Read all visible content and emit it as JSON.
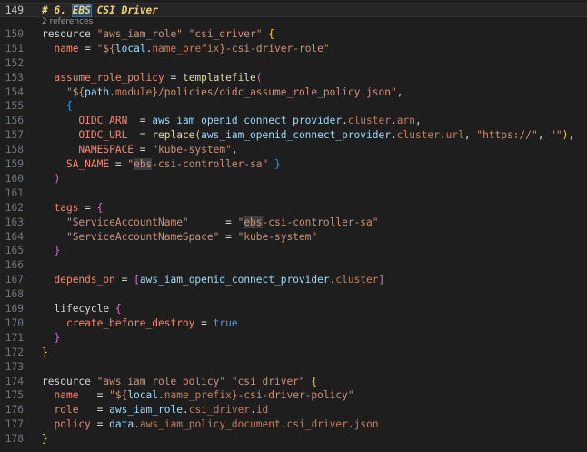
{
  "codelens": "2 references",
  "lines": [
    {
      "n": "149",
      "tokens": [
        {
          "c": "comment",
          "t": "# 6. "
        },
        {
          "c": "comment hl-box",
          "t": "EBS"
        },
        {
          "c": "comment",
          "t": " CSI Driver"
        }
      ]
    },
    {
      "n": "150",
      "tokens": [
        {
          "c": "kw",
          "t": "resource "
        },
        {
          "c": "str",
          "t": "\"aws_iam_role\""
        },
        {
          "c": "kw",
          "t": " "
        },
        {
          "c": "str",
          "t": "\"csi_driver\""
        },
        {
          "c": "kw",
          "t": " "
        },
        {
          "c": "b1",
          "t": "{"
        }
      ]
    },
    {
      "n": "151",
      "tokens": [
        {
          "c": "kw",
          "t": "  "
        },
        {
          "c": "prop",
          "t": "name"
        },
        {
          "c": "kw",
          "t": " = "
        },
        {
          "c": "str",
          "t": "\"${"
        },
        {
          "c": "ident",
          "t": "local"
        },
        {
          "c": "punct",
          "t": "."
        },
        {
          "c": "attr",
          "t": "name_prefix"
        },
        {
          "c": "str",
          "t": "}-csi-driver-role\""
        }
      ]
    },
    {
      "n": "152",
      "tokens": []
    },
    {
      "n": "153",
      "tokens": [
        {
          "c": "kw",
          "t": "  "
        },
        {
          "c": "prop",
          "t": "assume_role_policy"
        },
        {
          "c": "kw",
          "t": " = "
        },
        {
          "c": "func",
          "t": "templatefile"
        },
        {
          "c": "b2",
          "t": "("
        }
      ]
    },
    {
      "n": "154",
      "tokens": [
        {
          "c": "kw",
          "t": "    "
        },
        {
          "c": "str",
          "t": "\"${"
        },
        {
          "c": "ident",
          "t": "path"
        },
        {
          "c": "punct",
          "t": "."
        },
        {
          "c": "attr",
          "t": "module"
        },
        {
          "c": "str",
          "t": "}/policies/oidc_assume_role_policy.json\""
        },
        {
          "c": "punct",
          "t": ","
        }
      ]
    },
    {
      "n": "155",
      "tokens": [
        {
          "c": "kw",
          "t": "    "
        },
        {
          "c": "b3",
          "t": "{"
        }
      ]
    },
    {
      "n": "156",
      "tokens": [
        {
          "c": "kw",
          "t": "      "
        },
        {
          "c": "prop",
          "t": "OIDC_ARN"
        },
        {
          "c": "kw",
          "t": "  = "
        },
        {
          "c": "ident",
          "t": "aws_iam_openid_connect_provider"
        },
        {
          "c": "punct",
          "t": "."
        },
        {
          "c": "attr",
          "t": "cluster"
        },
        {
          "c": "punct",
          "t": "."
        },
        {
          "c": "attr",
          "t": "arn"
        },
        {
          "c": "punct",
          "t": ","
        }
      ]
    },
    {
      "n": "157",
      "tokens": [
        {
          "c": "kw",
          "t": "      "
        },
        {
          "c": "prop",
          "t": "OIDC_URL"
        },
        {
          "c": "kw",
          "t": "  = "
        },
        {
          "c": "func",
          "t": "replace"
        },
        {
          "c": "b1",
          "t": "("
        },
        {
          "c": "ident",
          "t": "aws_iam_openid_connect_provider"
        },
        {
          "c": "punct",
          "t": "."
        },
        {
          "c": "attr",
          "t": "cluster"
        },
        {
          "c": "punct",
          "t": "."
        },
        {
          "c": "attr",
          "t": "url"
        },
        {
          "c": "punct",
          "t": ", "
        },
        {
          "c": "str",
          "t": "\"https://\""
        },
        {
          "c": "punct",
          "t": ", "
        },
        {
          "c": "str",
          "t": "\"\""
        },
        {
          "c": "b1",
          "t": ")"
        },
        {
          "c": "punct",
          "t": ","
        }
      ]
    },
    {
      "n": "158",
      "tokens": [
        {
          "c": "kw",
          "t": "      "
        },
        {
          "c": "prop",
          "t": "NAMESPACE"
        },
        {
          "c": "kw",
          "t": " = "
        },
        {
          "c": "str",
          "t": "\"kube-system\""
        },
        {
          "c": "punct",
          "t": ","
        }
      ]
    },
    {
      "n": "159",
      "tokens": [
        {
          "c": "kw",
          "t": "    "
        },
        {
          "c": "prop",
          "t": "SA_NAME"
        },
        {
          "c": "kw",
          "t": " = "
        },
        {
          "c": "str",
          "t": "\""
        },
        {
          "c": "str hl",
          "t": "ebs"
        },
        {
          "c": "str",
          "t": "-csi-controller-sa\""
        },
        {
          "c": "kw",
          "t": " "
        },
        {
          "c": "b3",
          "t": "}"
        }
      ]
    },
    {
      "n": "160",
      "tokens": [
        {
          "c": "kw",
          "t": "  "
        },
        {
          "c": "b2",
          "t": ")"
        }
      ]
    },
    {
      "n": "161",
      "tokens": []
    },
    {
      "n": "162",
      "tokens": [
        {
          "c": "kw",
          "t": "  "
        },
        {
          "c": "prop",
          "t": "tags"
        },
        {
          "c": "kw",
          "t": " = "
        },
        {
          "c": "b2",
          "t": "{"
        }
      ]
    },
    {
      "n": "163",
      "tokens": [
        {
          "c": "kw",
          "t": "    "
        },
        {
          "c": "str",
          "t": "\"ServiceAccountName\""
        },
        {
          "c": "kw",
          "t": "      = "
        },
        {
          "c": "str",
          "t": "\""
        },
        {
          "c": "str hl",
          "t": "ebs"
        },
        {
          "c": "str",
          "t": "-csi-controller-sa\""
        }
      ]
    },
    {
      "n": "164",
      "tokens": [
        {
          "c": "kw",
          "t": "    "
        },
        {
          "c": "str",
          "t": "\"ServiceAccountNameSpace\""
        },
        {
          "c": "kw",
          "t": " = "
        },
        {
          "c": "str",
          "t": "\"kube-system\""
        }
      ]
    },
    {
      "n": "165",
      "tokens": [
        {
          "c": "kw",
          "t": "  "
        },
        {
          "c": "b2",
          "t": "}"
        }
      ]
    },
    {
      "n": "166",
      "tokens": []
    },
    {
      "n": "167",
      "tokens": [
        {
          "c": "kw",
          "t": "  "
        },
        {
          "c": "prop",
          "t": "depends_on"
        },
        {
          "c": "kw",
          "t": " = "
        },
        {
          "c": "b2",
          "t": "["
        },
        {
          "c": "ident",
          "t": "aws_iam_openid_connect_provider"
        },
        {
          "c": "punct",
          "t": "."
        },
        {
          "c": "attr",
          "t": "cluster"
        },
        {
          "c": "b2",
          "t": "]"
        }
      ]
    },
    {
      "n": "168",
      "tokens": []
    },
    {
      "n": "169",
      "tokens": [
        {
          "c": "kw",
          "t": "  "
        },
        {
          "c": "kw",
          "t": "lifecycle "
        },
        {
          "c": "b2",
          "t": "{"
        }
      ]
    },
    {
      "n": "170",
      "tokens": [
        {
          "c": "kw",
          "t": "    "
        },
        {
          "c": "prop",
          "t": "create_before_destroy"
        },
        {
          "c": "kw",
          "t": " = "
        },
        {
          "c": "const",
          "t": "true"
        }
      ]
    },
    {
      "n": "171",
      "tokens": [
        {
          "c": "kw",
          "t": "  "
        },
        {
          "c": "b2",
          "t": "}"
        }
      ]
    },
    {
      "n": "172",
      "tokens": [
        {
          "c": "b1",
          "t": "}"
        }
      ]
    },
    {
      "n": "173",
      "tokens": []
    },
    {
      "n": "174",
      "tokens": [
        {
          "c": "kw",
          "t": "resource "
        },
        {
          "c": "str",
          "t": "\"aws_iam_role_policy\""
        },
        {
          "c": "kw",
          "t": " "
        },
        {
          "c": "str",
          "t": "\"csi_driver\""
        },
        {
          "c": "kw",
          "t": " "
        },
        {
          "c": "b1",
          "t": "{"
        }
      ]
    },
    {
      "n": "175",
      "tokens": [
        {
          "c": "kw",
          "t": "  "
        },
        {
          "c": "prop",
          "t": "name"
        },
        {
          "c": "kw",
          "t": "   = "
        },
        {
          "c": "str",
          "t": "\"${"
        },
        {
          "c": "ident",
          "t": "local"
        },
        {
          "c": "punct",
          "t": "."
        },
        {
          "c": "attr",
          "t": "name_prefix"
        },
        {
          "c": "str",
          "t": "}-csi-driver-policy\""
        }
      ]
    },
    {
      "n": "176",
      "tokens": [
        {
          "c": "kw",
          "t": "  "
        },
        {
          "c": "prop",
          "t": "role"
        },
        {
          "c": "kw",
          "t": "   = "
        },
        {
          "c": "ident",
          "t": "aws_iam_role"
        },
        {
          "c": "punct",
          "t": "."
        },
        {
          "c": "attr",
          "t": "csi_driver"
        },
        {
          "c": "punct",
          "t": "."
        },
        {
          "c": "attr",
          "t": "id"
        }
      ]
    },
    {
      "n": "177",
      "tokens": [
        {
          "c": "kw",
          "t": "  "
        },
        {
          "c": "prop",
          "t": "policy"
        },
        {
          "c": "kw",
          "t": " = "
        },
        {
          "c": "ident",
          "t": "data"
        },
        {
          "c": "punct",
          "t": "."
        },
        {
          "c": "attr",
          "t": "aws_iam_policy_document"
        },
        {
          "c": "punct",
          "t": "."
        },
        {
          "c": "attr",
          "t": "csi_driver"
        },
        {
          "c": "punct",
          "t": "."
        },
        {
          "c": "attr",
          "t": "json"
        }
      ]
    },
    {
      "n": "178",
      "tokens": [
        {
          "c": "b1",
          "t": "}"
        }
      ]
    }
  ]
}
